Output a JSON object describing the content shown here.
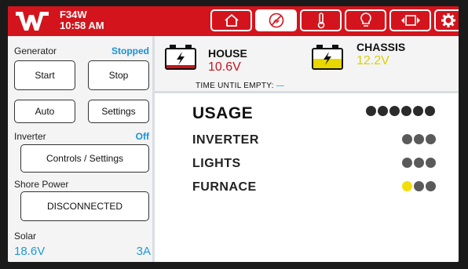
{
  "header": {
    "model": "F34W",
    "time": "10:58 AM",
    "logo_letter": "W",
    "tabs": [
      {
        "name": "home",
        "icon": "home-icon",
        "active": false
      },
      {
        "name": "power",
        "icon": "power-plug-icon",
        "active": true
      },
      {
        "name": "temperature",
        "icon": "thermometer-icon",
        "active": false
      },
      {
        "name": "lights",
        "icon": "lightbulb-icon",
        "active": false
      },
      {
        "name": "slide",
        "icon": "slide-out-icon",
        "active": false
      },
      {
        "name": "settings",
        "icon": "gear-icon",
        "active": false
      }
    ],
    "accent": "#d4141c"
  },
  "left": {
    "generator": {
      "label": "Generator",
      "status": "Stopped",
      "start": "Start",
      "stop": "Stop",
      "auto": "Auto",
      "settings": "Settings"
    },
    "inverter": {
      "label": "Inverter",
      "status": "Off",
      "controls": "Controls / Settings"
    },
    "shore": {
      "label": "Shore Power",
      "status": "DISCONNECTED"
    },
    "solar": {
      "label": "Solar",
      "voltage": "18.6V",
      "current": "3A"
    },
    "status_color": "#1b8fd6"
  },
  "batteries": {
    "house": {
      "name": "HOUSE",
      "voltage": "10.6V",
      "color": "#c8141c"
    },
    "chassis": {
      "name": "CHASSIS",
      "voltage": "12.2V",
      "color": "#e8d800"
    },
    "time_until_empty_label": "TIME UNTIL EMPTY:",
    "time_until_empty_value": "—"
  },
  "usage": {
    "title": "USAGE",
    "title_dots": 6,
    "items": [
      {
        "label": "INVERTER",
        "level": 0,
        "dots": 3
      },
      {
        "label": "LIGHTS",
        "level": 0,
        "dots": 3
      },
      {
        "label": "FURNACE",
        "level": 1,
        "dots": 3
      }
    ],
    "dot_color": "#2b2b2b",
    "dot_off_color": "#5a5a5a",
    "active_dot_color": "#f2de0a"
  }
}
